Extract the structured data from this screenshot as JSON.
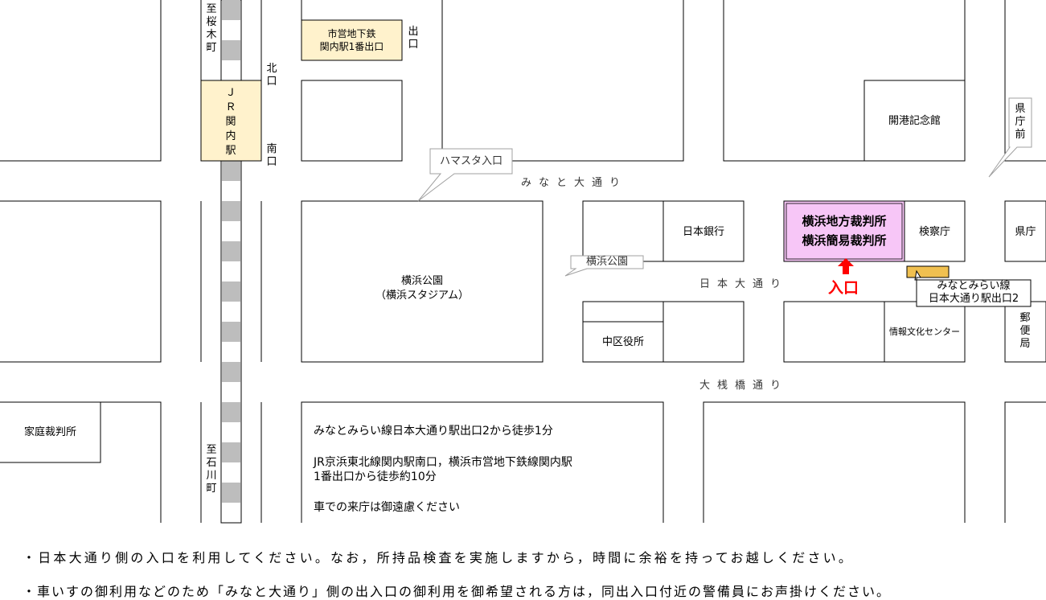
{
  "colors": {
    "court_fill": "#f7c6f7",
    "station_fill": "#fff2cc",
    "entrance_marker": "#ff0000",
    "exit_marker": "#f0c050",
    "callout_border": "#a0a0a0"
  },
  "labels": {
    "sakuragicho": "至桜木町",
    "ishikawacho": "至石川町",
    "jr_kannai": "ＪＲ関内駅",
    "north_exit": "北口",
    "south_exit": "南口",
    "subway_exit": "出口",
    "subway_station_line1": "市営地下鉄",
    "subway_station_line2": "関内駅1番出口",
    "kaiko_hall": "開港記念館",
    "kencho_mae": "県庁前",
    "kencho": "県庁",
    "boj": "日本銀行",
    "court_line1": "横浜地方裁判所",
    "court_line2": "横浜簡易裁判所",
    "prosecutor": "検察庁",
    "park_line1": "横浜公園",
    "park_line2": "（横浜スタジアム）",
    "park_callout": "横浜公園",
    "hamasta_callout": "ハマスタ入口",
    "minatomirai_line1": "みなとみらい線",
    "minatomirai_line2": "日本大通り駅出口2",
    "post_office": "郵便局",
    "info_center": "情報文化センター",
    "naka_ward": "中区役所",
    "family_court": "家庭裁判所",
    "entrance": "入口"
  },
  "streets": {
    "minato_odori": "みなと大通り",
    "nihon_odori": "日本大通り",
    "osanbashi": "大桟橋通り"
  },
  "directions": {
    "line1": "みなとみらい線日本大通り駅出口2から徒歩1分",
    "line2": "JR京浜東北線関内駅南口，横浜市営地下鉄線関内駅",
    "line3": "1番出口から徒歩約10分",
    "line4": "車での来庁は御遠慮ください"
  },
  "notes": {
    "note1": "・日本大通り側の入口を利用してください。なお，所持品検査を実施しますから，時間に余裕を持ってお越しください。",
    "note2": "・車いすの御利用などのため「みなと大通り」側の出入口の御利用を御希望される方は，同出入口付近の警備員にお声掛けください。"
  }
}
